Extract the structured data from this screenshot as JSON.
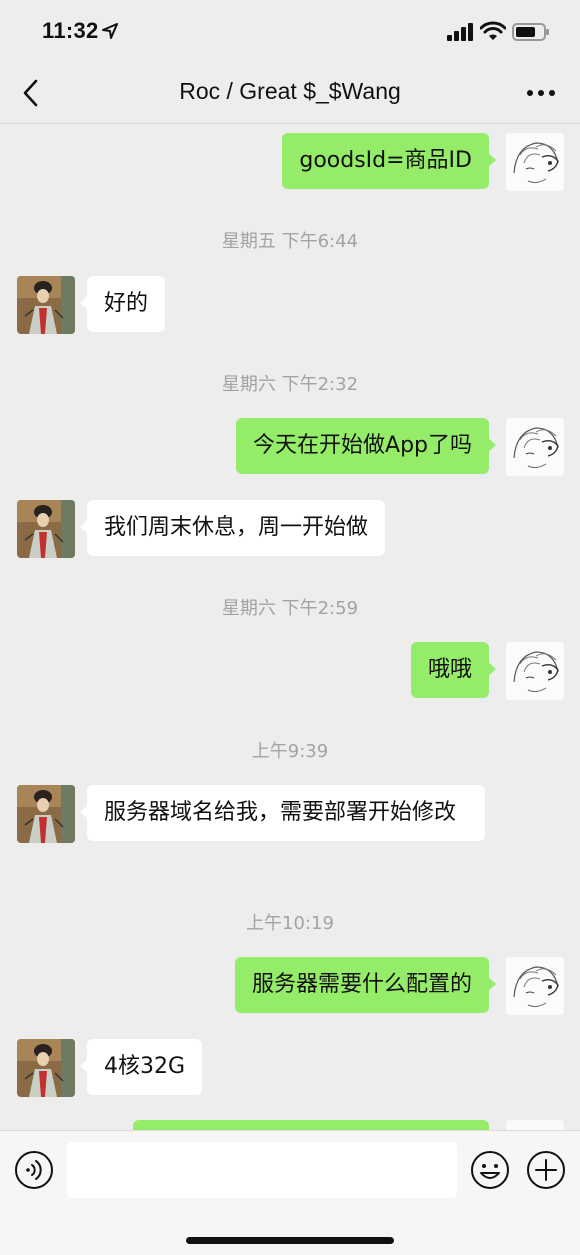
{
  "status_bar": {
    "time": "11:32"
  },
  "nav": {
    "title": "Roc / Great $_$Wang"
  },
  "messages": [
    {
      "text": "goodsId=商品ID"
    },
    {
      "time": "星期五 下午6:44"
    },
    {
      "text": "好的"
    },
    {
      "time": "星期六 下午2:32"
    },
    {
      "text": "今天在开始做App了吗"
    },
    {
      "text": "我们周末休息，周一开始做"
    },
    {
      "time": "星期六 下午2:59"
    },
    {
      "text": "哦哦"
    },
    {
      "time": "上午9:39"
    },
    {
      "text": "服务器域名给我，需要部署开始修改"
    },
    {
      "time": "上午10:19"
    },
    {
      "text": "服务器需要什么配置的"
    },
    {
      "text": "4核32G"
    }
  ],
  "input": {
    "placeholder": ""
  }
}
